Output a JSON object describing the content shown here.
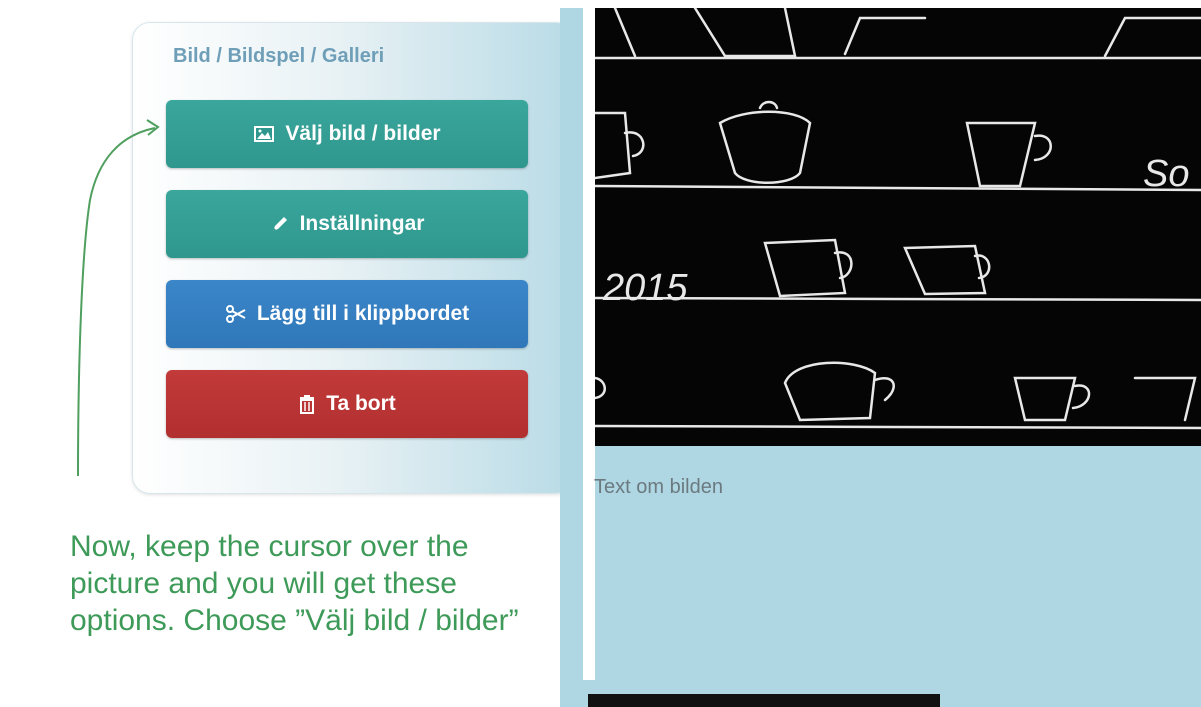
{
  "panel": {
    "title": "Bild / Bildspel / Galleri",
    "buttons": {
      "choose_image": {
        "label": "Välj bild / bilder",
        "icon": "image-icon",
        "color": "#35a096"
      },
      "settings": {
        "label": "Inställningar",
        "icon": "pencil-icon",
        "color": "#35a096"
      },
      "clipboard": {
        "label": "Lägg till i klippbordet",
        "icon": "scissors-icon",
        "color": "#347fc2"
      },
      "delete": {
        "label": "Ta bort",
        "icon": "trash-icon",
        "color": "#bb3535"
      }
    }
  },
  "preview": {
    "image_text": {
      "year": "2015",
      "partial_word": "So"
    },
    "caption": "Text om bilden"
  },
  "tutorial": {
    "instruction": "Now, keep the cursor over the picture and you will get these options. Choose ”Välj bild / bilder”",
    "arrow_color": "#4f9f5f"
  },
  "colors": {
    "panel_title": "#6f9fb8",
    "background_right": "#aed6e3",
    "instruction_text": "#3e9a58"
  }
}
